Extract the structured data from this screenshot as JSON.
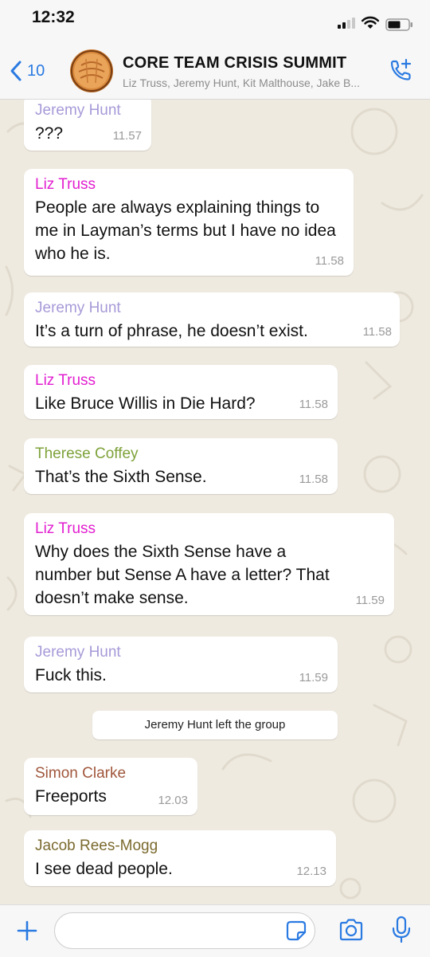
{
  "status": {
    "time": "12:32"
  },
  "header": {
    "back_count": "10",
    "title": "CORE TEAM CRISIS SUMMIT",
    "subtitle": "Liz Truss, Jeremy Hunt, Kit Malthouse, Jake B..."
  },
  "colors": {
    "jeremy": "#a79ad8",
    "liz": "#e21fd0",
    "therese": "#7ea23a",
    "simon": "#a0573c",
    "jacob": "#7b6a2f",
    "accent": "#2a7ae2"
  },
  "messages": [
    {
      "sender": "Jeremy Hunt",
      "text": "???",
      "time": "11.57"
    },
    {
      "sender": "Liz Truss",
      "text": "People are always explaining things to me in Layman’s terms but I have no idea who he is.",
      "time": "11.58"
    },
    {
      "sender": "Jeremy Hunt",
      "text": "It’s a turn of phrase, he doesn’t exist.",
      "time": "11.58"
    },
    {
      "sender": "Liz Truss",
      "text": "Like Bruce Willis in Die Hard?",
      "time": "11.58"
    },
    {
      "sender": "Therese Coffey",
      "text": "That’s the Sixth Sense.",
      "time": "11.58"
    },
    {
      "sender": "Liz Truss",
      "text": "Why does the Sixth Sense have a number but Sense A have a letter? That doesn’t make sense.",
      "time": "11.59"
    },
    {
      "sender": "Jeremy Hunt",
      "text": "Fuck this.",
      "time": "11.59"
    },
    {
      "sender": "Simon Clarke",
      "text": "Freeports",
      "time": "12.03"
    },
    {
      "sender": "Jacob Rees-Mogg",
      "text": "I see dead people.",
      "time": "12.13"
    }
  ],
  "system_message": "Jeremy Hunt left the group",
  "icons": {
    "back": "chevron-left-icon",
    "call": "add-call-icon",
    "plus": "plus-icon",
    "sticker": "sticker-icon",
    "camera": "camera-icon",
    "mic": "microphone-icon"
  }
}
